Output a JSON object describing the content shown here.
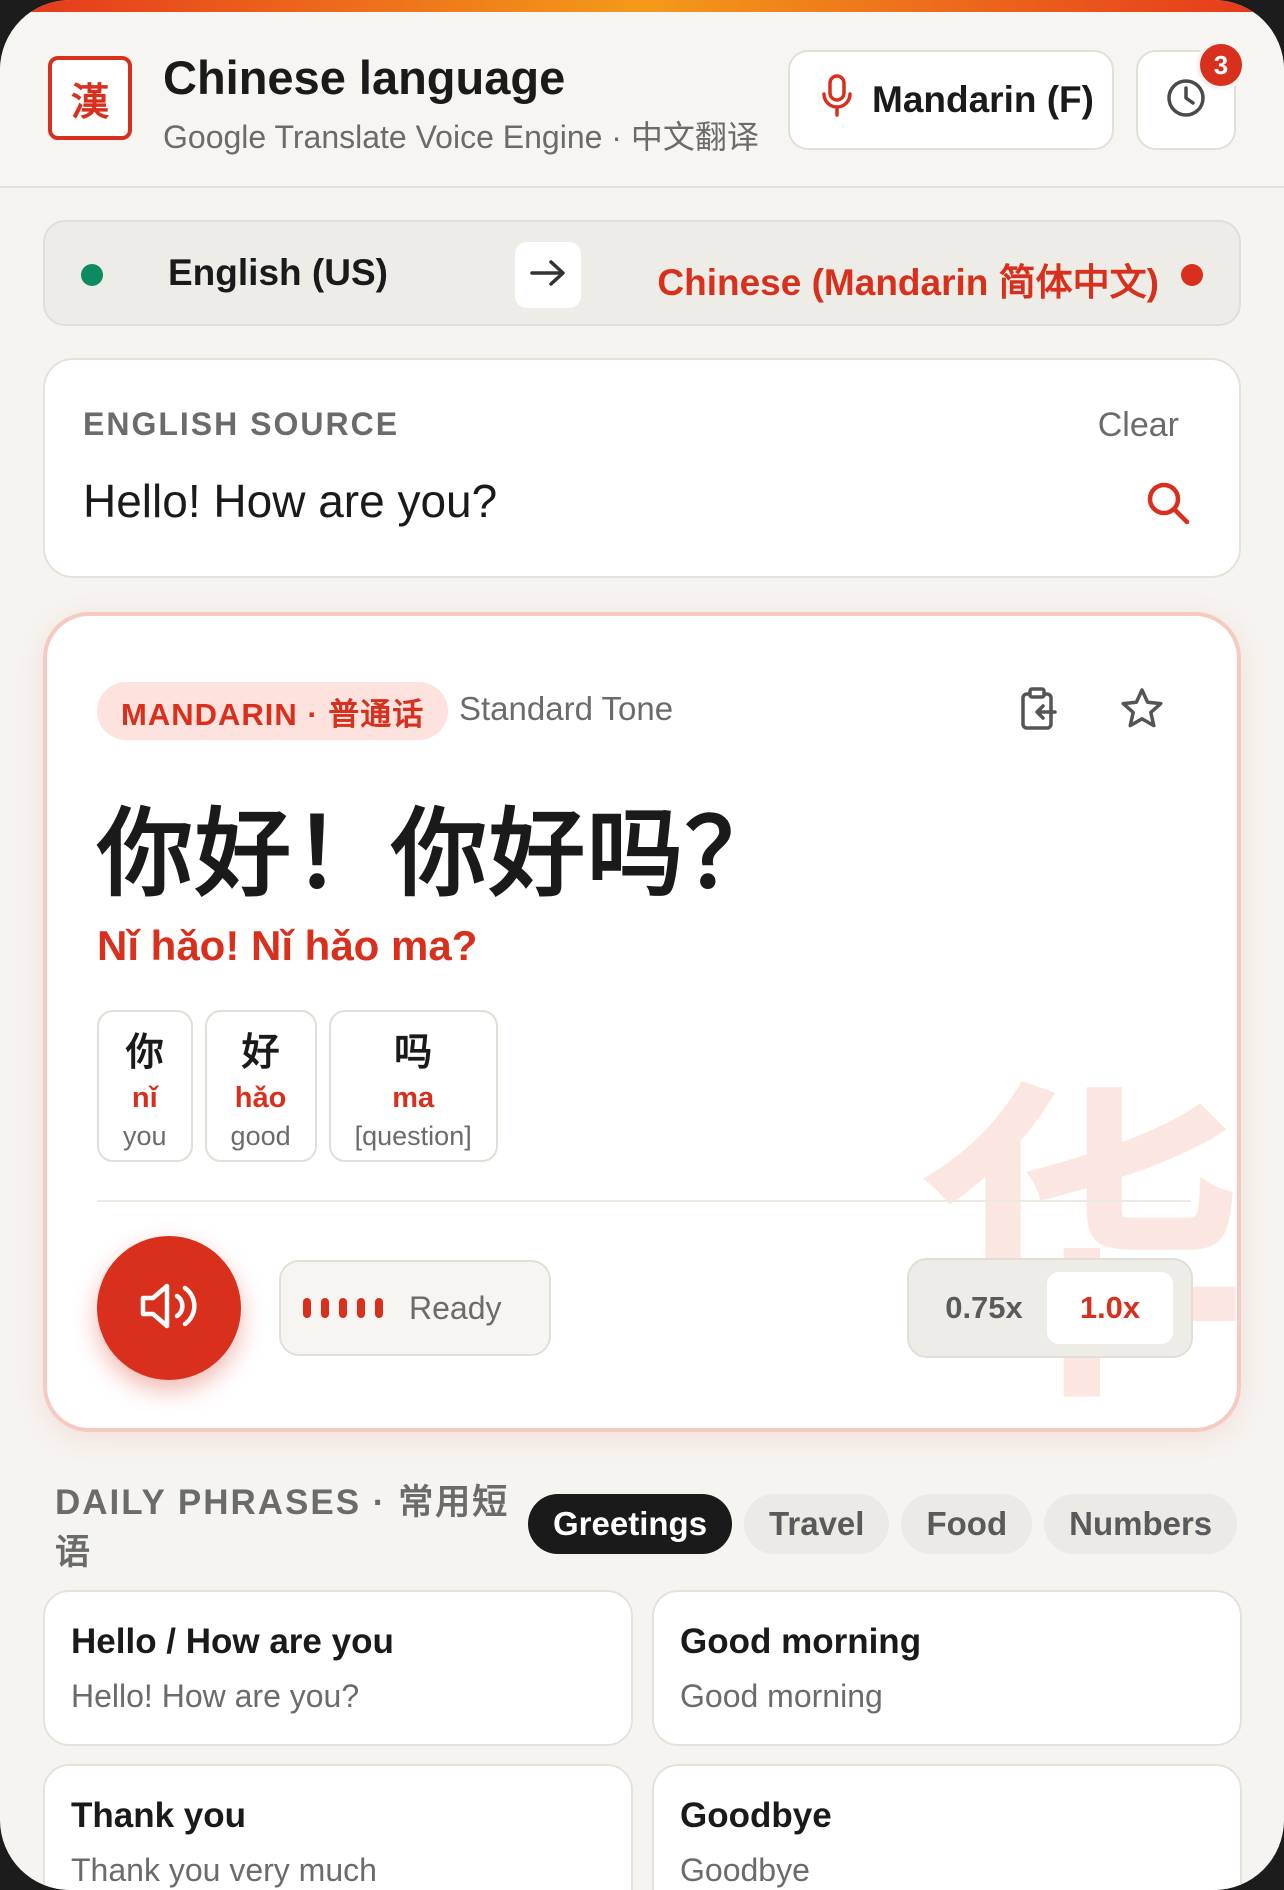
{
  "header": {
    "logo_char": "漢",
    "title": "Chinese language",
    "subtitle": "Google Translate Voice Engine · 中文翻译",
    "voice_label": "Mandarin (F)",
    "history_badge": "3"
  },
  "languages": {
    "source": "English (US)",
    "target": "Chinese (Mandarin 简体中文)",
    "source_color": "#0e8a62",
    "target_color": "#d8301d"
  },
  "source_card": {
    "label": "ENGLISH SOURCE",
    "clear_label": "Clear",
    "text": "Hello! How are you?"
  },
  "translation": {
    "pill": "MANDARIN · 普通话",
    "tone": "Standard Tone",
    "hanzi": "你好！你好吗？",
    "pinyin": "Nǐ hǎo! Nǐ hǎo ma?",
    "watermark": "华",
    "chars": [
      {
        "char": "你",
        "pinyin": "nǐ",
        "meaning": "you"
      },
      {
        "char": "好",
        "pinyin": "hǎo",
        "meaning": "good"
      },
      {
        "char": "吗",
        "pinyin": "ma",
        "meaning": "[question]"
      }
    ],
    "status": "Ready",
    "speeds": [
      "0.75x",
      "1.0x"
    ],
    "active_speed": "1.0x"
  },
  "phrases": {
    "title": "DAILY PHRASES · 常用短语",
    "tabs": [
      "Greetings",
      "Travel",
      "Food",
      "Numbers"
    ],
    "active_tab": "Greetings",
    "items": [
      {
        "title": "Hello / How are you",
        "subtitle": "Hello! How are you?"
      },
      {
        "title": "Good morning",
        "subtitle": "Good morning"
      },
      {
        "title": "Thank you",
        "subtitle": "Thank you very much"
      },
      {
        "title": "Goodbye",
        "subtitle": "Goodbye"
      }
    ]
  },
  "colors": {
    "accent": "#d8301d",
    "dark": "#1a1a1a",
    "background": "#f6f4f0"
  }
}
